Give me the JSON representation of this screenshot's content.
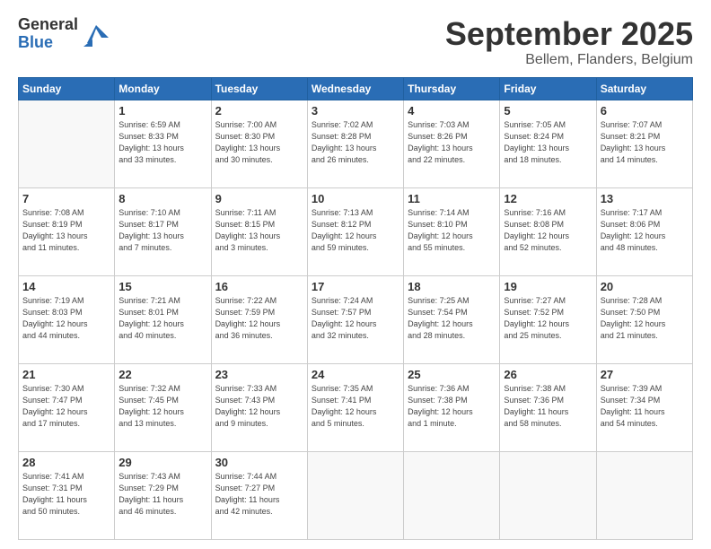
{
  "logo": {
    "general": "General",
    "blue": "Blue"
  },
  "header": {
    "month": "September 2025",
    "location": "Bellem, Flanders, Belgium"
  },
  "weekdays": [
    "Sunday",
    "Monday",
    "Tuesday",
    "Wednesday",
    "Thursday",
    "Friday",
    "Saturday"
  ],
  "weeks": [
    [
      {
        "day": "",
        "sunrise": "",
        "sunset": "",
        "daylight": ""
      },
      {
        "day": "1",
        "sunrise": "Sunrise: 6:59 AM",
        "sunset": "Sunset: 8:33 PM",
        "daylight": "Daylight: 13 hours and 33 minutes."
      },
      {
        "day": "2",
        "sunrise": "Sunrise: 7:00 AM",
        "sunset": "Sunset: 8:30 PM",
        "daylight": "Daylight: 13 hours and 30 minutes."
      },
      {
        "day": "3",
        "sunrise": "Sunrise: 7:02 AM",
        "sunset": "Sunset: 8:28 PM",
        "daylight": "Daylight: 13 hours and 26 minutes."
      },
      {
        "day": "4",
        "sunrise": "Sunrise: 7:03 AM",
        "sunset": "Sunset: 8:26 PM",
        "daylight": "Daylight: 13 hours and 22 minutes."
      },
      {
        "day": "5",
        "sunrise": "Sunrise: 7:05 AM",
        "sunset": "Sunset: 8:24 PM",
        "daylight": "Daylight: 13 hours and 18 minutes."
      },
      {
        "day": "6",
        "sunrise": "Sunrise: 7:07 AM",
        "sunset": "Sunset: 8:21 PM",
        "daylight": "Daylight: 13 hours and 14 minutes."
      }
    ],
    [
      {
        "day": "7",
        "sunrise": "Sunrise: 7:08 AM",
        "sunset": "Sunset: 8:19 PM",
        "daylight": "Daylight: 13 hours and 11 minutes."
      },
      {
        "day": "8",
        "sunrise": "Sunrise: 7:10 AM",
        "sunset": "Sunset: 8:17 PM",
        "daylight": "Daylight: 13 hours and 7 minutes."
      },
      {
        "day": "9",
        "sunrise": "Sunrise: 7:11 AM",
        "sunset": "Sunset: 8:15 PM",
        "daylight": "Daylight: 13 hours and 3 minutes."
      },
      {
        "day": "10",
        "sunrise": "Sunrise: 7:13 AM",
        "sunset": "Sunset: 8:12 PM",
        "daylight": "Daylight: 12 hours and 59 minutes."
      },
      {
        "day": "11",
        "sunrise": "Sunrise: 7:14 AM",
        "sunset": "Sunset: 8:10 PM",
        "daylight": "Daylight: 12 hours and 55 minutes."
      },
      {
        "day": "12",
        "sunrise": "Sunrise: 7:16 AM",
        "sunset": "Sunset: 8:08 PM",
        "daylight": "Daylight: 12 hours and 52 minutes."
      },
      {
        "day": "13",
        "sunrise": "Sunrise: 7:17 AM",
        "sunset": "Sunset: 8:06 PM",
        "daylight": "Daylight: 12 hours and 48 minutes."
      }
    ],
    [
      {
        "day": "14",
        "sunrise": "Sunrise: 7:19 AM",
        "sunset": "Sunset: 8:03 PM",
        "daylight": "Daylight: 12 hours and 44 minutes."
      },
      {
        "day": "15",
        "sunrise": "Sunrise: 7:21 AM",
        "sunset": "Sunset: 8:01 PM",
        "daylight": "Daylight: 12 hours and 40 minutes."
      },
      {
        "day": "16",
        "sunrise": "Sunrise: 7:22 AM",
        "sunset": "Sunset: 7:59 PM",
        "daylight": "Daylight: 12 hours and 36 minutes."
      },
      {
        "day": "17",
        "sunrise": "Sunrise: 7:24 AM",
        "sunset": "Sunset: 7:57 PM",
        "daylight": "Daylight: 12 hours and 32 minutes."
      },
      {
        "day": "18",
        "sunrise": "Sunrise: 7:25 AM",
        "sunset": "Sunset: 7:54 PM",
        "daylight": "Daylight: 12 hours and 28 minutes."
      },
      {
        "day": "19",
        "sunrise": "Sunrise: 7:27 AM",
        "sunset": "Sunset: 7:52 PM",
        "daylight": "Daylight: 12 hours and 25 minutes."
      },
      {
        "day": "20",
        "sunrise": "Sunrise: 7:28 AM",
        "sunset": "Sunset: 7:50 PM",
        "daylight": "Daylight: 12 hours and 21 minutes."
      }
    ],
    [
      {
        "day": "21",
        "sunrise": "Sunrise: 7:30 AM",
        "sunset": "Sunset: 7:47 PM",
        "daylight": "Daylight: 12 hours and 17 minutes."
      },
      {
        "day": "22",
        "sunrise": "Sunrise: 7:32 AM",
        "sunset": "Sunset: 7:45 PM",
        "daylight": "Daylight: 12 hours and 13 minutes."
      },
      {
        "day": "23",
        "sunrise": "Sunrise: 7:33 AM",
        "sunset": "Sunset: 7:43 PM",
        "daylight": "Daylight: 12 hours and 9 minutes."
      },
      {
        "day": "24",
        "sunrise": "Sunrise: 7:35 AM",
        "sunset": "Sunset: 7:41 PM",
        "daylight": "Daylight: 12 hours and 5 minutes."
      },
      {
        "day": "25",
        "sunrise": "Sunrise: 7:36 AM",
        "sunset": "Sunset: 7:38 PM",
        "daylight": "Daylight: 12 hours and 1 minute."
      },
      {
        "day": "26",
        "sunrise": "Sunrise: 7:38 AM",
        "sunset": "Sunset: 7:36 PM",
        "daylight": "Daylight: 11 hours and 58 minutes."
      },
      {
        "day": "27",
        "sunrise": "Sunrise: 7:39 AM",
        "sunset": "Sunset: 7:34 PM",
        "daylight": "Daylight: 11 hours and 54 minutes."
      }
    ],
    [
      {
        "day": "28",
        "sunrise": "Sunrise: 7:41 AM",
        "sunset": "Sunset: 7:31 PM",
        "daylight": "Daylight: 11 hours and 50 minutes."
      },
      {
        "day": "29",
        "sunrise": "Sunrise: 7:43 AM",
        "sunset": "Sunset: 7:29 PM",
        "daylight": "Daylight: 11 hours and 46 minutes."
      },
      {
        "day": "30",
        "sunrise": "Sunrise: 7:44 AM",
        "sunset": "Sunset: 7:27 PM",
        "daylight": "Daylight: 11 hours and 42 minutes."
      },
      {
        "day": "",
        "sunrise": "",
        "sunset": "",
        "daylight": ""
      },
      {
        "day": "",
        "sunrise": "",
        "sunset": "",
        "daylight": ""
      },
      {
        "day": "",
        "sunrise": "",
        "sunset": "",
        "daylight": ""
      },
      {
        "day": "",
        "sunrise": "",
        "sunset": "",
        "daylight": ""
      }
    ]
  ]
}
